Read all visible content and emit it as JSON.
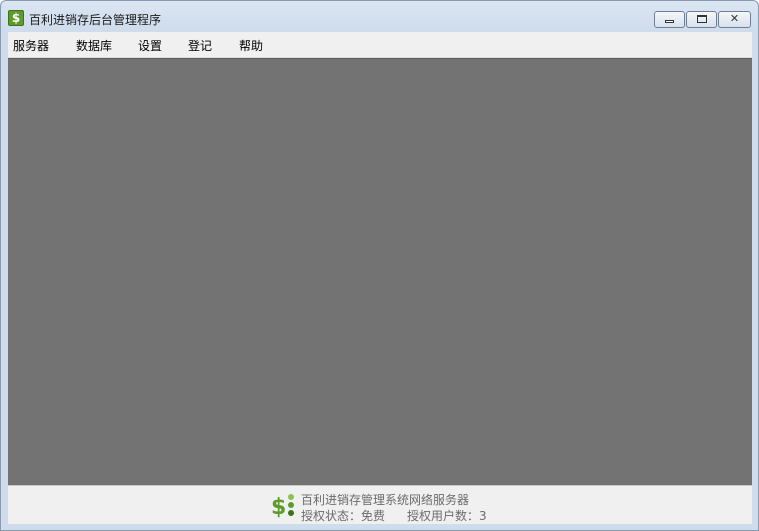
{
  "window": {
    "title": "百利进销存后台管理程序",
    "icon": "dollar-app-icon",
    "icon_glyph": "$"
  },
  "controls": {
    "minimize": "minimize-icon",
    "maximize": "maximize-icon",
    "close": "close-icon",
    "close_glyph": "✕"
  },
  "menu": {
    "items": [
      {
        "label": "服务器"
      },
      {
        "label": "数据库"
      },
      {
        "label": "设置"
      },
      {
        "label": "登记"
      },
      {
        "label": "帮助"
      }
    ]
  },
  "status": {
    "product_name": "百利进销存管理系统网络服务器",
    "auth_state_label": "授权状态：",
    "auth_state_value": "免费",
    "auth_users_label": "授权用户数：",
    "auth_users_value": "3",
    "logo": "dollar-logo-icon"
  },
  "colors": {
    "workspace": "#737373",
    "menubar": "#f0f0f0",
    "logo_green": "#5d9b2a"
  }
}
